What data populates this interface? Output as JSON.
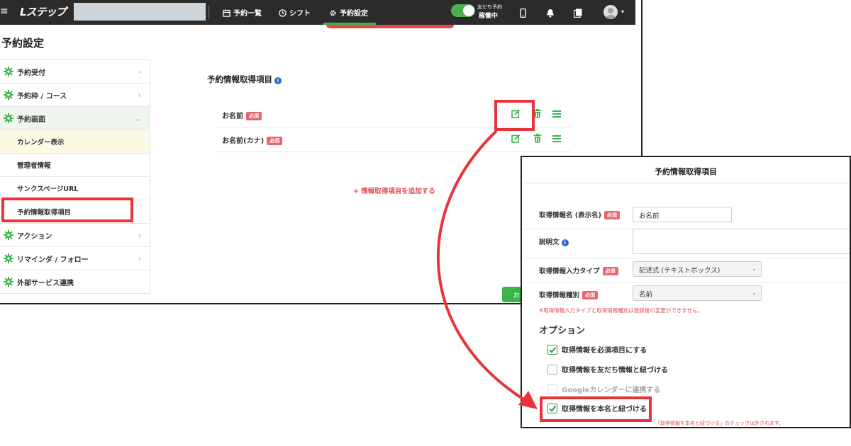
{
  "header": {
    "menu_glyph": "≡",
    "logo": "Lステップ",
    "nav": [
      {
        "label": "予約一覧",
        "icon": "calendar-icon"
      },
      {
        "label": "シフト",
        "icon": "clock-icon"
      },
      {
        "label": "予約設定",
        "icon": "gear-icon"
      }
    ],
    "toggle_label_top": "友だち予約",
    "toggle_label_bottom": "稼働中"
  },
  "page": {
    "title": "予約設定"
  },
  "sidebar": {
    "items": [
      {
        "label": "予約受付"
      },
      {
        "label": "予約枠 / コース"
      },
      {
        "label": "予約画面"
      }
    ],
    "sub_items": [
      {
        "label": "カレンダー表示"
      },
      {
        "label": "管理者情報"
      },
      {
        "label": "サンクスページURL"
      },
      {
        "label": "予約情報取得項目"
      }
    ],
    "items_after": [
      {
        "label": "アクション"
      },
      {
        "label": "リマインダ / フォロー"
      },
      {
        "label": "外部サービス連携"
      }
    ]
  },
  "main": {
    "section_title": "予約情報取得項目",
    "info_glyph": "i",
    "rows": [
      {
        "name": "お名前",
        "badge": "必須"
      },
      {
        "name": "お名前(カナ)",
        "badge": "必須"
      }
    ],
    "add_link": "情報取得項目を追加する",
    "add_plus": "+",
    "green_button_fragment": "お"
  },
  "modal": {
    "title": "予約情報取得項目",
    "fields": {
      "name_label": "取得情報名 (表示名)",
      "name_badge": "必須",
      "name_value": "お名前",
      "desc_label": "説明文",
      "input_type_label": "取得情報入力タイプ",
      "input_type_badge": "必須",
      "input_type_value": "記述式 (テキストボックス)",
      "kind_label": "取得情報種別",
      "kind_badge": "必須",
      "kind_value": "名前"
    },
    "note": "※取得情報入力タイプと取得情報種別は登録後の変更ができません。",
    "options_heading": "オプション",
    "options": [
      {
        "label": "取得情報を必須項目にする",
        "checked": true,
        "disabled": false
      },
      {
        "label": "取得情報を友だち情報と紐づける",
        "checked": false,
        "disabled": false
      },
      {
        "label": "Googleカレンダーに連携する",
        "checked": false,
        "disabled": true
      },
      {
        "label": "取得情報を本名と紐づける",
        "checked": true,
        "disabled": false
      }
    ],
    "bottom_note": "「取得情報を本名と紐づける」のチェックは外されます。"
  },
  "colors": {
    "brand_green": "#3bb54a",
    "highlight_red": "#e8333b",
    "badge_red": "#e8676f"
  }
}
